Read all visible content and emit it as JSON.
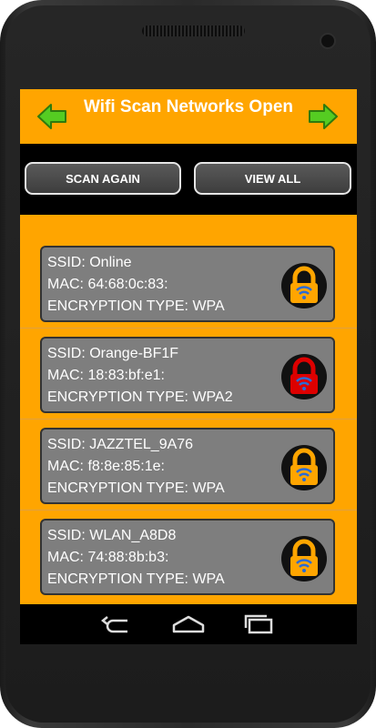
{
  "header": {
    "title": "Wifi Scan Networks Open"
  },
  "buttons": {
    "scan_label": "SCAN AGAIN",
    "view_label": "VIEW ALL"
  },
  "networks": [
    {
      "ssid": "SSID: Online",
      "mac": "MAC: 64:68:0c:83:",
      "enc": "ENCRYPTION TYPE: WPA",
      "lock_color": "#ffa500"
    },
    {
      "ssid": "SSID: Orange-BF1F",
      "mac": "MAC: 18:83:bf:e1:",
      "enc": "ENCRYPTION TYPE: WPA2",
      "lock_color": "#dd0000"
    },
    {
      "ssid": "SSID: JAZZTEL_9A76",
      "mac": "MAC: f8:8e:85:1e:",
      "enc": "ENCRYPTION TYPE: WPA",
      "lock_color": "#ffa500"
    },
    {
      "ssid": "SSID: WLAN_A8D8",
      "mac": "MAC: 74:88:8b:b3:",
      "enc": "ENCRYPTION TYPE: WPA",
      "lock_color": "#ffa500"
    }
  ],
  "colors": {
    "accent": "#ffa500",
    "card_bg": "#7e7e7e",
    "arrow_green": "#55cc22"
  },
  "icons": {
    "back": "back-arrow-icon",
    "forward": "forward-arrow-icon",
    "lock": "wifi-lock-icon",
    "nav_back": "back-icon",
    "nav_home": "home-icon",
    "nav_recent": "recent-apps-icon"
  }
}
